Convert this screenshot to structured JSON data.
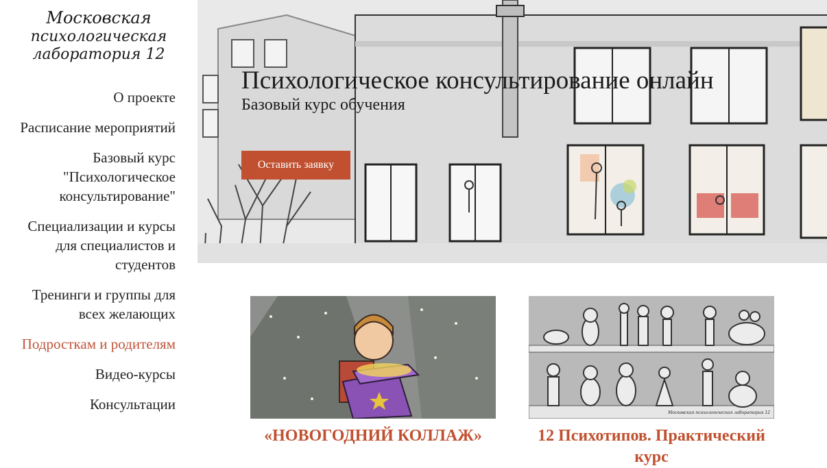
{
  "logo": {
    "line1": "Московская",
    "line2": "психологическая",
    "line3": "лаборатория 12"
  },
  "nav": {
    "items": [
      {
        "label": "О проекте"
      },
      {
        "label": "Расписание мероприятий"
      },
      {
        "label": "Базовый курс \"Психологическое консультирование\""
      },
      {
        "label": "Специализации и курсы для специалистов и студентов"
      },
      {
        "label": "Тренинги и группы для всех желающих"
      },
      {
        "label": "Подросткам и родителям"
      },
      {
        "label": "Видео-курсы"
      },
      {
        "label": "Консультации"
      }
    ],
    "active_index": 5
  },
  "hero": {
    "title": "Психологическое консультирование онлайн",
    "subtitle": "Базовый курс обучения",
    "cta_label": "Оставить заявку"
  },
  "cards": [
    {
      "title": "«НОВОГОДНИЙ КОЛЛАЖ»"
    },
    {
      "title": "12 Психотипов. Практический курс",
      "image_caption": "Московская психологическая лаборатория 12"
    }
  ],
  "colors": {
    "accent": "#c0502f",
    "active_nav": "#c0553a",
    "text": "#222222"
  }
}
